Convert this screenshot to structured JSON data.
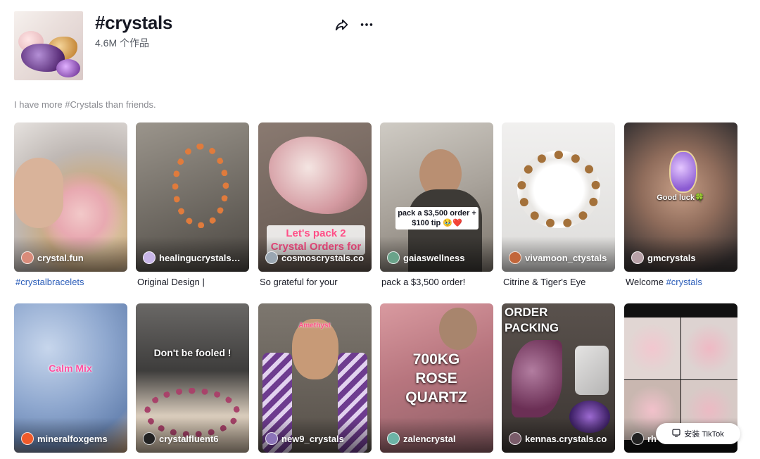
{
  "hashtag": {
    "title": "#crystals",
    "count": "4.6M 个作品",
    "description": "I have more #Crystals than friends."
  },
  "actions": {
    "share_icon": "share-arrow-icon",
    "more_icon": "ellipsis-icon"
  },
  "videos": [
    {
      "author": "crystal.fun",
      "caption": "#crystalbracelets",
      "caption_is_tag": true,
      "overlay": ""
    },
    {
      "author": "healingucrystals_...",
      "caption": "Original Design |",
      "overlay": ""
    },
    {
      "author": "cosmoscrystals.co",
      "caption": "So grateful for your",
      "overlay": "Let's pack 2 Crystal Orders for"
    },
    {
      "author": "gaiaswellness",
      "caption": "pack a $3,500 order!",
      "overlay": "pack a $3,500 order + $100 tip 🥹❤️"
    },
    {
      "author": "vivamoon_ctystals",
      "caption": "Citrine & Tiger's Eye",
      "overlay": ""
    },
    {
      "author": "gmcrystals",
      "caption_prefix": "Welcome ",
      "caption_tag": "#crystals",
      "overlay": "Good luck🍀"
    },
    {
      "author": "mineralfoxgems",
      "overlay": "Calm Mix"
    },
    {
      "author": "crystalfluent6",
      "overlay": "Don't be fooled !"
    },
    {
      "author": "new9_crystals",
      "overlay": "Amethyst"
    },
    {
      "author": "zalencrystal",
      "overlay": "700KG ROSE QUARTZ"
    },
    {
      "author": "kennas.crystals.co",
      "overlay": "ORDER PACKING"
    },
    {
      "author": "rh"
    }
  ],
  "install_button": {
    "label": "安装 TikTok",
    "icon": "download-app-icon"
  },
  "colors": {
    "hashtag_link": "#2b5db9",
    "text_primary": "#161823",
    "text_secondary": "#8a8b91"
  }
}
